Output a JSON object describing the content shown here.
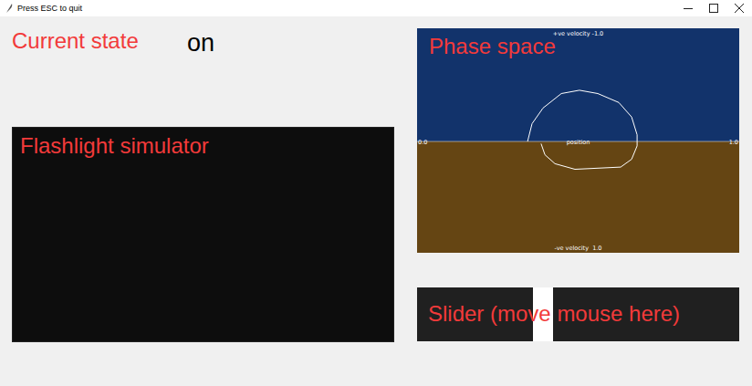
{
  "window": {
    "title": "Press ESC to quit"
  },
  "state": {
    "label": "Current state",
    "value": "on"
  },
  "flashlight": {
    "label": "Flashlight simulator"
  },
  "phase_space": {
    "label": "Phase space",
    "top_label": "+ve velocity -1.0",
    "bottom_label": "-ve velocity  1.0",
    "x_min": "0.0",
    "x_max": "1.0",
    "x_label": "position",
    "trajectory": {
      "position": [
        0.343,
        0.357,
        0.391,
        0.448,
        0.504,
        0.561,
        0.626,
        0.666,
        0.683,
        0.683,
        0.666,
        0.632,
        0.561,
        0.49,
        0.428,
        0.397,
        0.385
      ],
      "velocity": [
        0,
        -0.16,
        -0.3,
        -0.43,
        -0.46,
        -0.43,
        -0.35,
        -0.22,
        -0.06,
        0.04,
        0.16,
        0.23,
        0.24,
        0.25,
        0.2,
        0.12,
        0.02
      ]
    }
  },
  "slider": {
    "label": "Slider (move mouse here)",
    "level": 0.39
  }
}
